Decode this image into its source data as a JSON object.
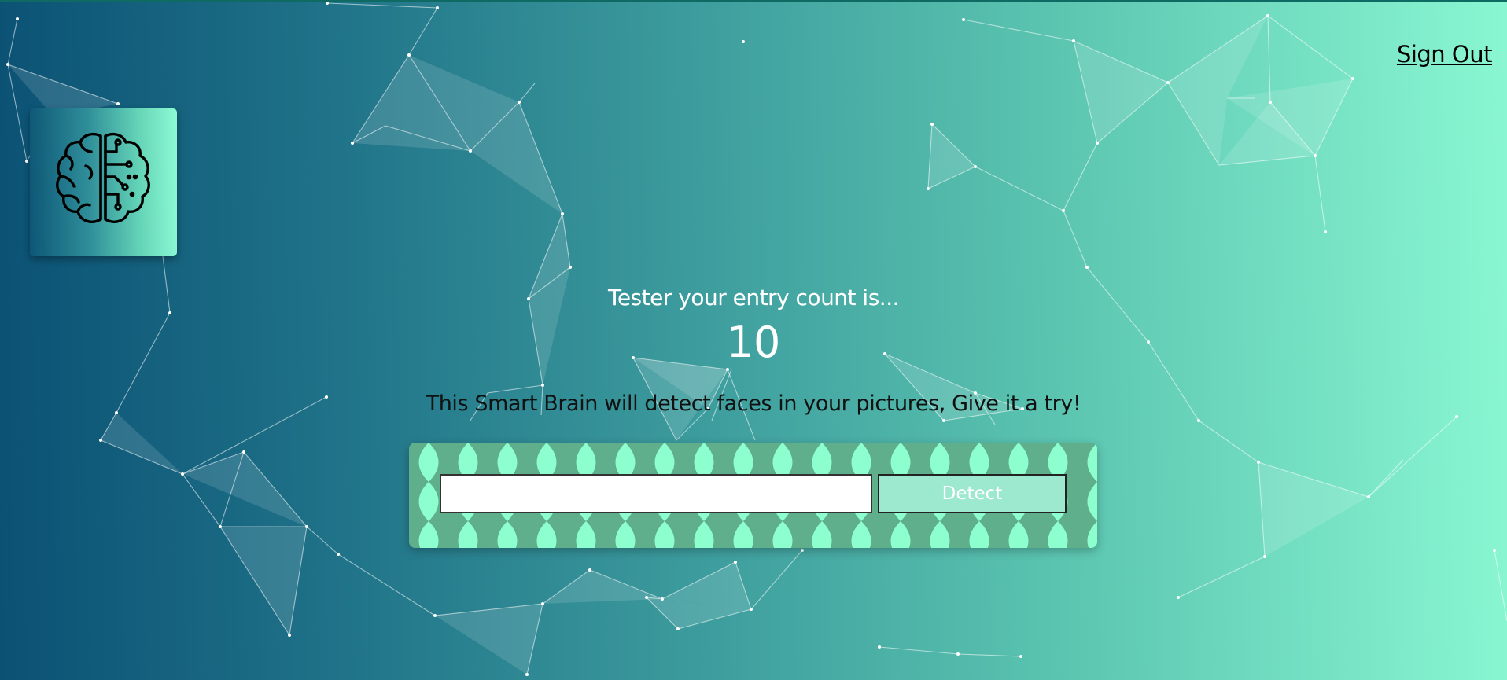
{
  "nav": {
    "sign_out_label": "Sign Out"
  },
  "logo": {
    "icon": "brain-circuit-icon"
  },
  "rank": {
    "entry_text": "Tester your entry count is...",
    "count": "10"
  },
  "main": {
    "tagline": "This Smart Brain will detect faces in your pictures, Give it a try!"
  },
  "form": {
    "url_value": "",
    "url_placeholder": "",
    "detect_label": "Detect"
  },
  "colors": {
    "gradient_start": "#0b5174",
    "gradient_end": "#8af7d2",
    "form_background": "#5fae8c",
    "form_pattern": "#8dffce",
    "detect_button": "#9de9cf"
  }
}
